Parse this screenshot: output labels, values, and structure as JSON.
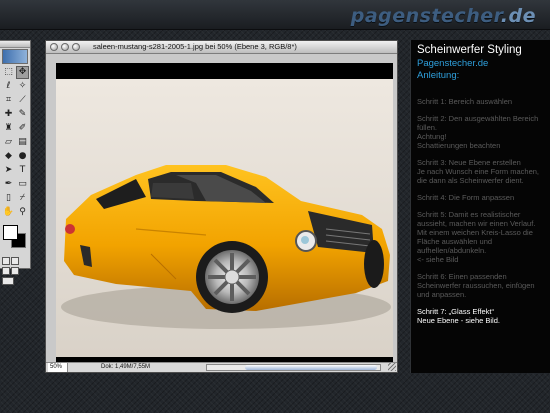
{
  "site": {
    "logo_main": "pagenstecher",
    "logo_tld": ".de"
  },
  "document": {
    "title": "saleen-mustang-s281-2005-1.jpg bei 50% (Ebene 3, RGB/8*)",
    "zoom": "50%",
    "doc_info": "Dok: 1,49M/7,55M"
  },
  "toolbox": {
    "tools": [
      "marquee",
      "move",
      "lasso",
      "magic-wand",
      "crop",
      "slice",
      "healing",
      "brush",
      "stamp",
      "history-brush",
      "eraser",
      "gradient",
      "blur",
      "dodge",
      "path-select",
      "type",
      "pen",
      "shape",
      "notes",
      "eyedropper",
      "hand",
      "zoom"
    ]
  },
  "panel": {
    "title": "Scheinwerfer Styling",
    "subtitle_1": "Pagenstecher.de",
    "subtitle_2": "Anleitung:",
    "steps": [
      {
        "lines": [
          "Schritt 1: Bereich auswählen"
        ]
      },
      {
        "lines": [
          "Schritt 2: Den ausgewählten Bereich füllen.",
          "Achtung!",
          "Schattierungen beachten"
        ]
      },
      {
        "lines": [
          "Schritt 3: Neue Ebene erstellen",
          "Je nach Wunsch eine Form machen, die dann als Scheinwerfer dient."
        ]
      },
      {
        "lines": [
          "Schritt 4: Die Form anpassen"
        ]
      },
      {
        "lines": [
          "Schritt 5: Damit es realistischer aussieht, machen wir einen Verlauf.",
          "Mit einem weichen Kreis-Lasso die Fläche auswählen und aufhellen/abdunkeln.",
          "<- siehe Bild"
        ]
      },
      {
        "lines": [
          "Schritt 6: Einen passenden Scheinwerfer raussuchen, einfügen und anpassen."
        ]
      }
    ],
    "active_step": [
      "Schritt 7: „Glass Effekt“",
      "Neue Ebene - siehe Bild."
    ]
  },
  "colors": {
    "accent": "#2fa0dd",
    "car_body": "#f0a400",
    "dim_text": "#5b5b5b"
  }
}
